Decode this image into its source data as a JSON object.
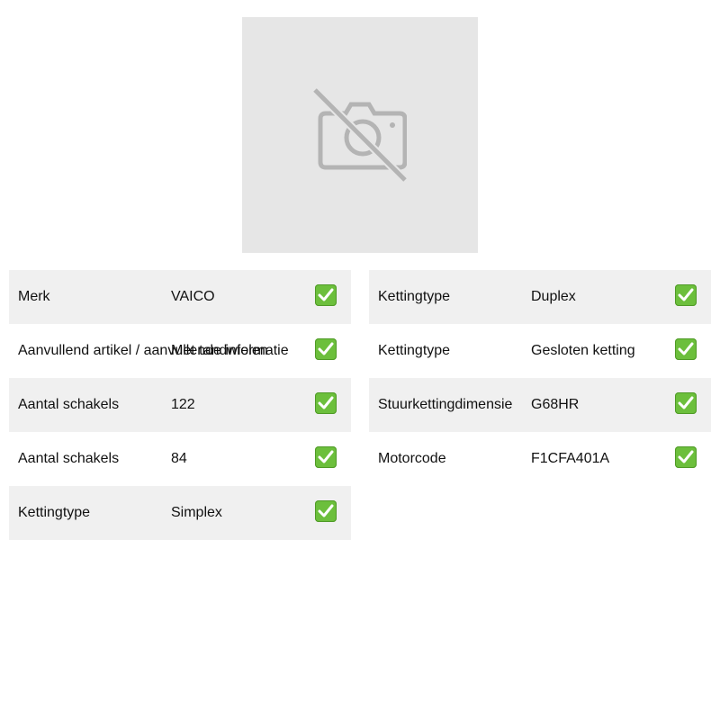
{
  "image": {
    "icon": "camera-off-icon"
  },
  "colors": {
    "row_shade": "#f0f0f0",
    "check": "#6cbf3c",
    "placeholder": "#e6e6e6"
  },
  "left_rows": [
    {
      "label": "Merk",
      "value": "VAICO"
    },
    {
      "label": "Aanvullend artikel / aanvullende informatie",
      "value": "Met tandwielen"
    },
    {
      "label": "Aantal schakels",
      "value": "122"
    },
    {
      "label": "Aantal schakels",
      "value": "84"
    },
    {
      "label": "Kettingtype",
      "value": "Simplex"
    }
  ],
  "right_rows": [
    {
      "label": "Kettingtype",
      "value": "Duplex"
    },
    {
      "label": "Kettingtype",
      "value": "Gesloten ketting"
    },
    {
      "label": "Stuurkettingdimensie",
      "value": "G68HR"
    },
    {
      "label": "Motorcode",
      "value": "F1CFA401A"
    }
  ]
}
